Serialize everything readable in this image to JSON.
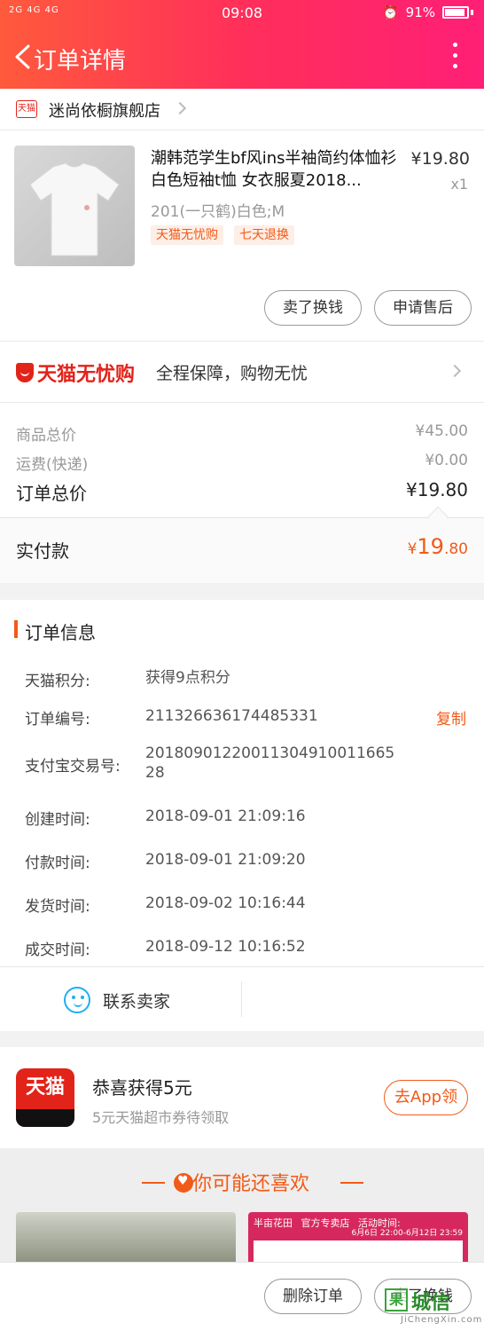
{
  "status_bar": {
    "signal": "2G 4G 4G",
    "time": "09:08",
    "battery": "91%"
  },
  "nav": {
    "title": "订单详情"
  },
  "shop": {
    "badge": "天猫",
    "name": "迷尚依橱旗舰店"
  },
  "product": {
    "title": "潮韩范学生bf风ins半袖简约体恤衫白色短袖t恤 女衣服夏2018...",
    "price": "¥19.80",
    "qty": "x1",
    "sku": "201(一只鹤)白色;M",
    "tags": [
      "天猫无忧购",
      "七天退换"
    ],
    "actions": [
      "卖了换钱",
      "申请售后"
    ]
  },
  "worry_free": {
    "logo": "天猫无忧购",
    "text": "全程保障，购物无忧"
  },
  "pricing": {
    "goods_label": "商品总价",
    "goods_value": "¥45.00",
    "shipping_label": "运费(快递)",
    "shipping_value": "¥0.00",
    "total_label": "订单总价",
    "total_value": "¥19.80",
    "paid_label": "实付款",
    "paid_symbol": "¥",
    "paid_int": "19",
    "paid_dec": ".80"
  },
  "order_info": {
    "title": "订单信息",
    "copy": "复制",
    "rows": [
      {
        "label": "天猫积分:",
        "value": "获得9点积分"
      },
      {
        "label": "订单编号:",
        "value": "211326636174485331"
      },
      {
        "label": "支付宝交易号:",
        "value": "2018090122001130491001166528"
      },
      {
        "label": "创建时间:",
        "value": "2018-09-01 21:09:16"
      },
      {
        "label": "付款时间:",
        "value": "2018-09-01 21:09:20"
      },
      {
        "label": "发货时间:",
        "value": "2018-09-02 10:16:44"
      },
      {
        "label": "成交时间:",
        "value": "2018-09-12 10:16:52"
      }
    ]
  },
  "contact": {
    "label": "联系卖家"
  },
  "promo": {
    "app_name": "天猫",
    "title": "恭喜获得5元",
    "subtitle": "5元天猫超市券待领取",
    "button": "去App领"
  },
  "recommend": {
    "title": "你可能还喜欢",
    "item2_brand": "半亩花田",
    "item2_store": "官方专卖店",
    "item2_activity": "活动时间:",
    "item2_dates": "6月6日 22:00-6月12日 23:59"
  },
  "bottom_actions": {
    "delete": "删除订单",
    "sell": "卖了换钱"
  },
  "watermark": {
    "glyph": "果",
    "text": "城信",
    "sub": "JiChengXin.com"
  }
}
